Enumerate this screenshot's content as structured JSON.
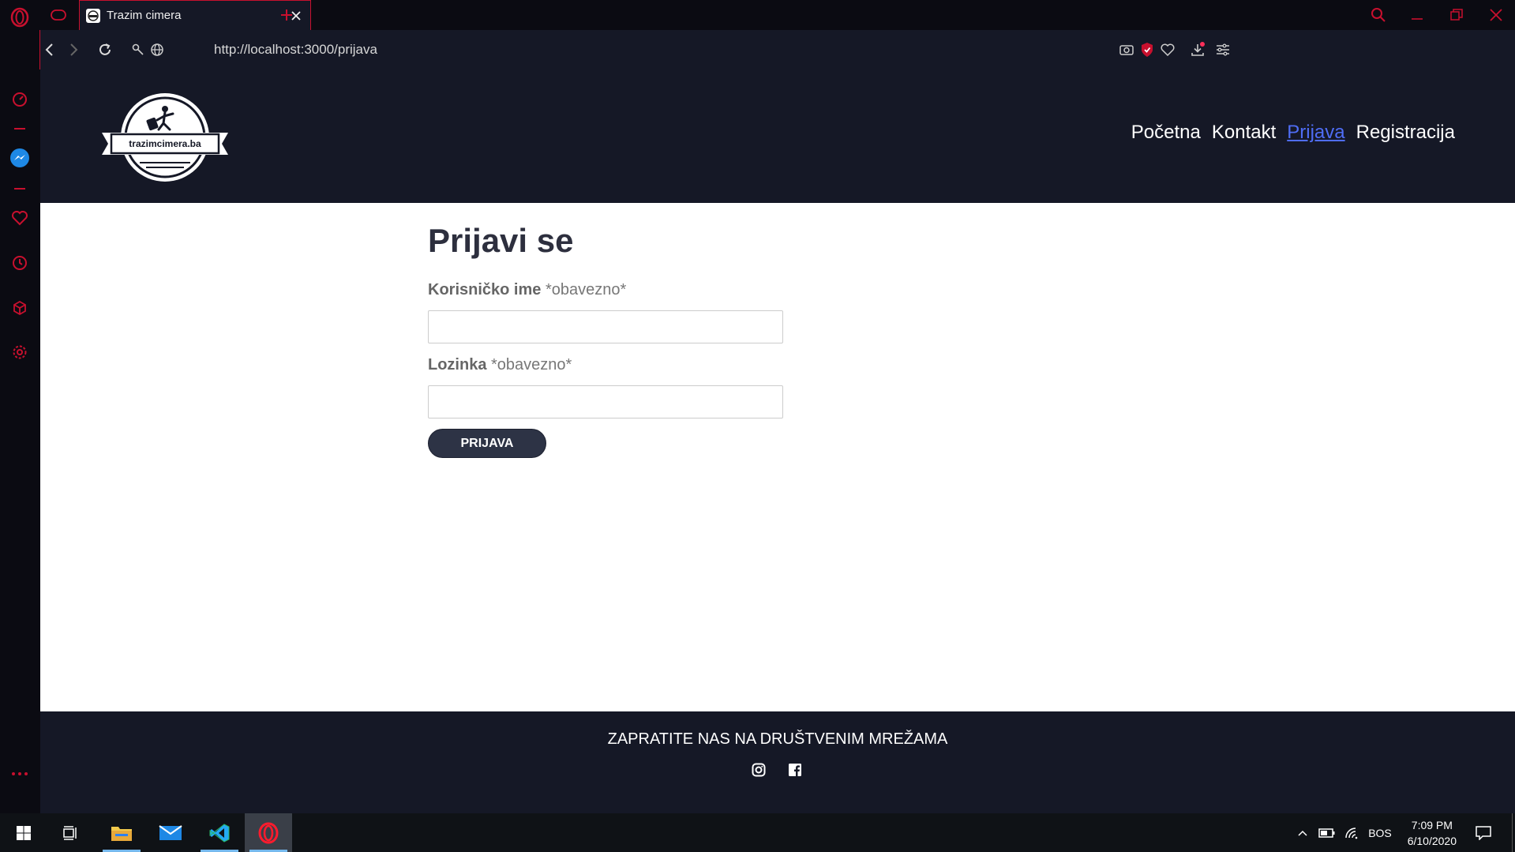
{
  "browser": {
    "tab_title": "Trazim cimera",
    "url": "http://localhost:3000/prijava",
    "accent": "#c8102e"
  },
  "site": {
    "logo_text": "trazimcimera.ba",
    "nav": [
      {
        "label": "Početna",
        "active": false
      },
      {
        "label": "Kontakt",
        "active": false
      },
      {
        "label": "Prijava",
        "active": true
      },
      {
        "label": "Registracija",
        "active": false
      }
    ],
    "link_active_color": "#4f6df5",
    "header_bg": "#151826"
  },
  "login": {
    "heading": "Prijavi se",
    "username_label": "Korisničko ime",
    "username_required": "*obavezno*",
    "password_label": "Lozinka",
    "password_required": "*obavezno*",
    "submit_label": "PRIJAVA"
  },
  "footer": {
    "title": "ZAPRATITE NAS NA DRUŠTVENIM MREŽAMA",
    "socials": [
      "instagram-icon",
      "facebook-icon"
    ]
  },
  "taskbar": {
    "language": "BOS",
    "time": "7:09 PM",
    "date": "6/10/2020"
  }
}
